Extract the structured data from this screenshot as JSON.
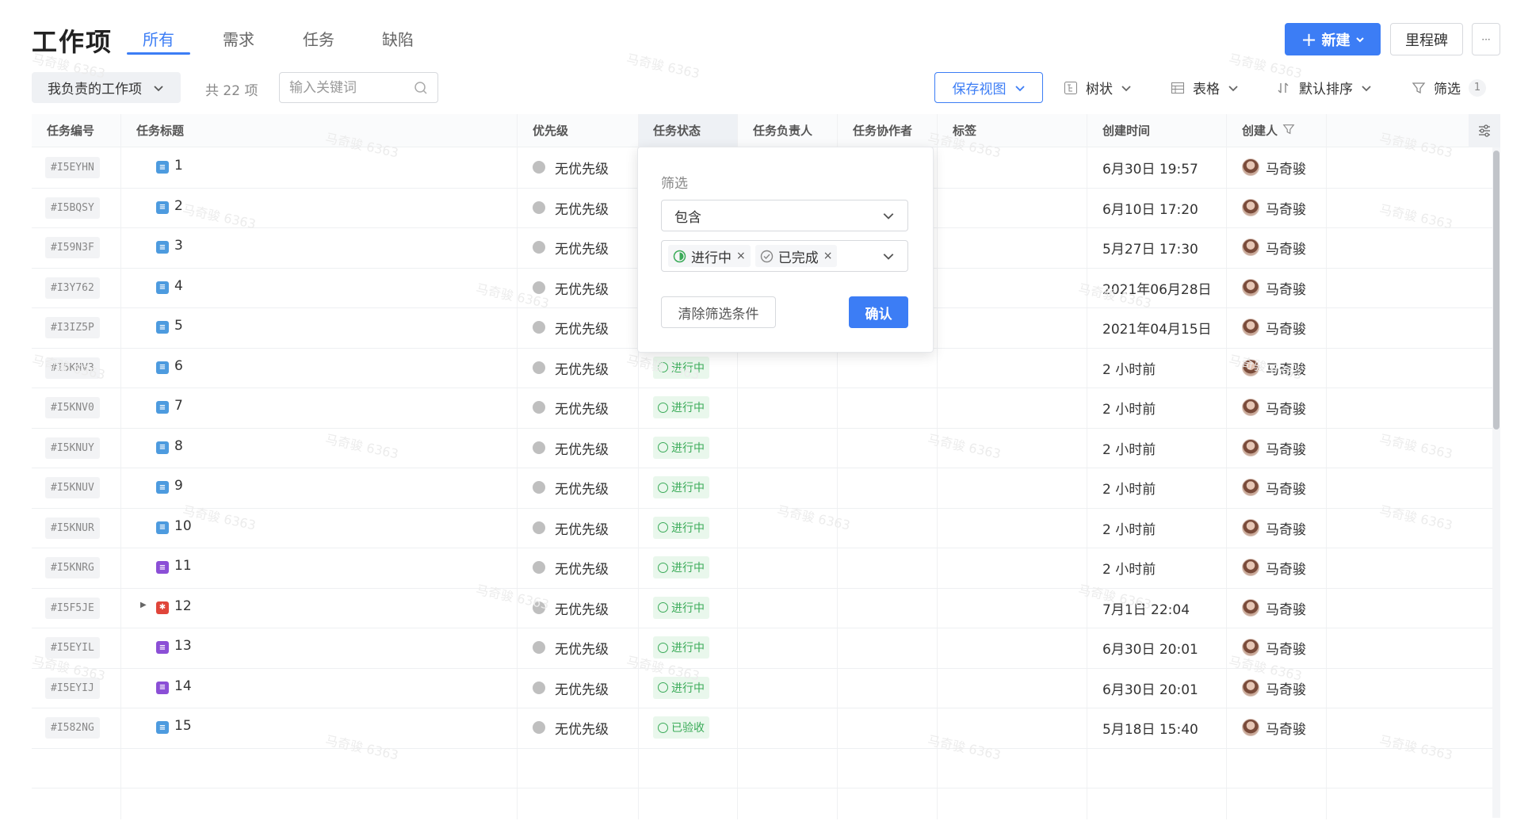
{
  "header": {
    "title": "工作项",
    "tabs": [
      {
        "label": "所有",
        "active": true
      },
      {
        "label": "需求",
        "active": false
      },
      {
        "label": "任务",
        "active": false
      },
      {
        "label": "缺陷",
        "active": false
      }
    ],
    "new_button": "新建",
    "milestone_button": "里程碑",
    "more_button": "···"
  },
  "toolbar": {
    "view_select": "我负责的工作项",
    "count": "共 22 项",
    "search_placeholder": "输入关键词",
    "save_view": "保存视图",
    "tree": "树状",
    "table": "表格",
    "sort": "默认排序",
    "filter": "筛选",
    "filter_count": "1"
  },
  "table": {
    "columns": [
      "任务编号",
      "任务标题",
      "优先级",
      "任务状态",
      "任务负责人",
      "任务协作者",
      "标签",
      "创建时间",
      "创建人"
    ],
    "rows": [
      {
        "id": "#I5EYHN",
        "title": "1",
        "type": "task",
        "priority": "无优先级",
        "status": "",
        "created": "6月30日 19:57",
        "creator": "马奇骏"
      },
      {
        "id": "#I5BQSY",
        "title": "2",
        "type": "task",
        "priority": "无优先级",
        "status": "",
        "created": "6月10日 17:20",
        "creator": "马奇骏"
      },
      {
        "id": "#I59N3F",
        "title": "3",
        "type": "task",
        "priority": "无优先级",
        "status": "",
        "created": "5月27日 17:30",
        "creator": "马奇骏"
      },
      {
        "id": "#I3Y762",
        "title": "4",
        "type": "task",
        "priority": "无优先级",
        "status": "",
        "created": "2021年06月28日",
        "creator": "马奇骏"
      },
      {
        "id": "#I3IZ5P",
        "title": "5",
        "type": "task",
        "priority": "无优先级",
        "status": "",
        "created": "2021年04月15日",
        "creator": "马奇骏"
      },
      {
        "id": "#I5KNV3",
        "title": "6",
        "type": "task",
        "priority": "无优先级",
        "status": "进行中",
        "created": "2 小时前",
        "creator": "马奇骏"
      },
      {
        "id": "#I5KNV0",
        "title": "7",
        "type": "task",
        "priority": "无优先级",
        "status": "进行中",
        "created": "2 小时前",
        "creator": "马奇骏"
      },
      {
        "id": "#I5KNUY",
        "title": "8",
        "type": "task",
        "priority": "无优先级",
        "status": "进行中",
        "created": "2 小时前",
        "creator": "马奇骏"
      },
      {
        "id": "#I5KNUV",
        "title": "9",
        "type": "task",
        "priority": "无优先级",
        "status": "进行中",
        "created": "2 小时前",
        "creator": "马奇骏"
      },
      {
        "id": "#I5KNUR",
        "title": "10",
        "type": "task",
        "priority": "无优先级",
        "status": "进行中",
        "created": "2 小时前",
        "creator": "马奇骏"
      },
      {
        "id": "#I5KNRG",
        "title": "11",
        "type": "requirement",
        "priority": "无优先级",
        "status": "进行中",
        "created": "2 小时前",
        "creator": "马奇骏"
      },
      {
        "id": "#I5F5JE",
        "title": "12",
        "type": "bug",
        "priority": "无优先级",
        "status": "进行中",
        "created": "7月1日 22:04",
        "creator": "马奇骏"
      },
      {
        "id": "#I5EYIL",
        "title": "13",
        "type": "requirement",
        "priority": "无优先级",
        "status": "进行中",
        "created": "6月30日 20:01",
        "creator": "马奇骏"
      },
      {
        "id": "#I5EYIJ",
        "title": "14",
        "type": "requirement",
        "priority": "无优先级",
        "status": "进行中",
        "created": "6月30日 20:01",
        "creator": "马奇骏"
      },
      {
        "id": "#I582NG",
        "title": "15",
        "type": "task",
        "priority": "无优先级",
        "status": "已验收",
        "created": "5月18日 15:40",
        "creator": "马奇骏"
      }
    ]
  },
  "filter_popup": {
    "label": "筛选",
    "operator": "包含",
    "chips": [
      "进行中",
      "已完成"
    ],
    "clear_button": "清除筛选条件",
    "confirm_button": "确认"
  },
  "watermark": "马奇骏 6363",
  "colors": {
    "accent": "#3c7df5",
    "task_icon": "#4d9bdf",
    "requirement_icon": "#8b4fd6",
    "bug_icon": "#e0453a",
    "status_green": "#3aab58"
  }
}
